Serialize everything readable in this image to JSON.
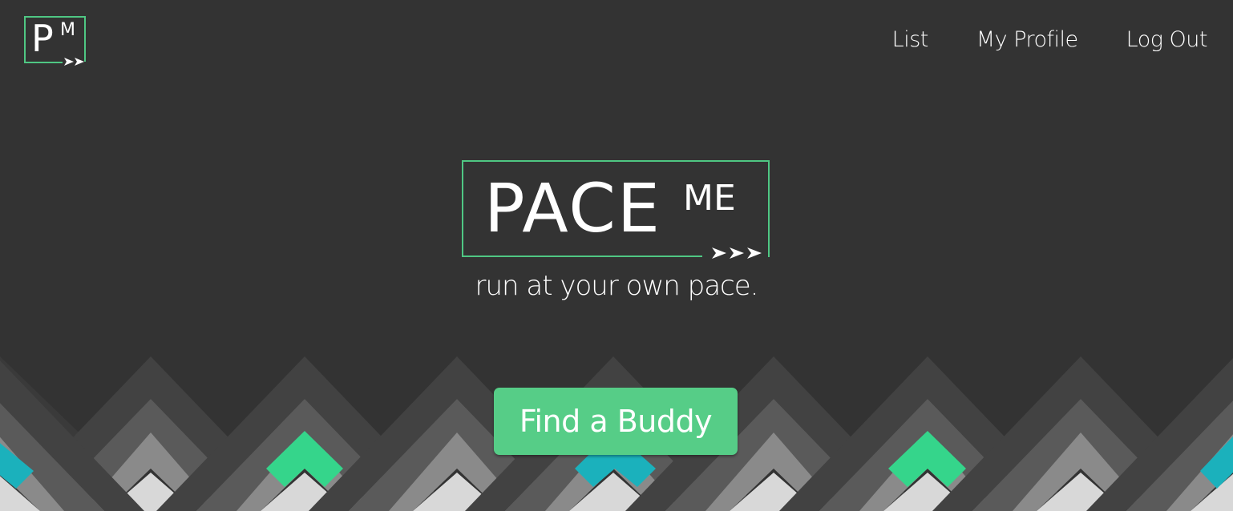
{
  "brand": {
    "small_logo": {
      "letter_p": "P",
      "letter_m": "M",
      "arrows": "➤➤"
    },
    "hero_logo": {
      "word_pace": "PACE",
      "word_me": "ME",
      "arrows": "➤➤➤"
    },
    "tagline": "run at your own pace."
  },
  "nav": {
    "items": [
      {
        "label": "List"
      },
      {
        "label": "My Profile"
      },
      {
        "label": "Log Out"
      }
    ]
  },
  "hero": {
    "cta_label": "Find a Buddy"
  },
  "colors": {
    "background": "#333333",
    "brand_green": "#4fc783",
    "button_green": "#56cd87",
    "accent_green": "#35d58b",
    "accent_teal": "#1bb1bc",
    "chevron_dark": "#404040",
    "chevron_mid": "#555555",
    "chevron_gray": "#8a8a8a",
    "chevron_light": "#d6d6d6"
  }
}
